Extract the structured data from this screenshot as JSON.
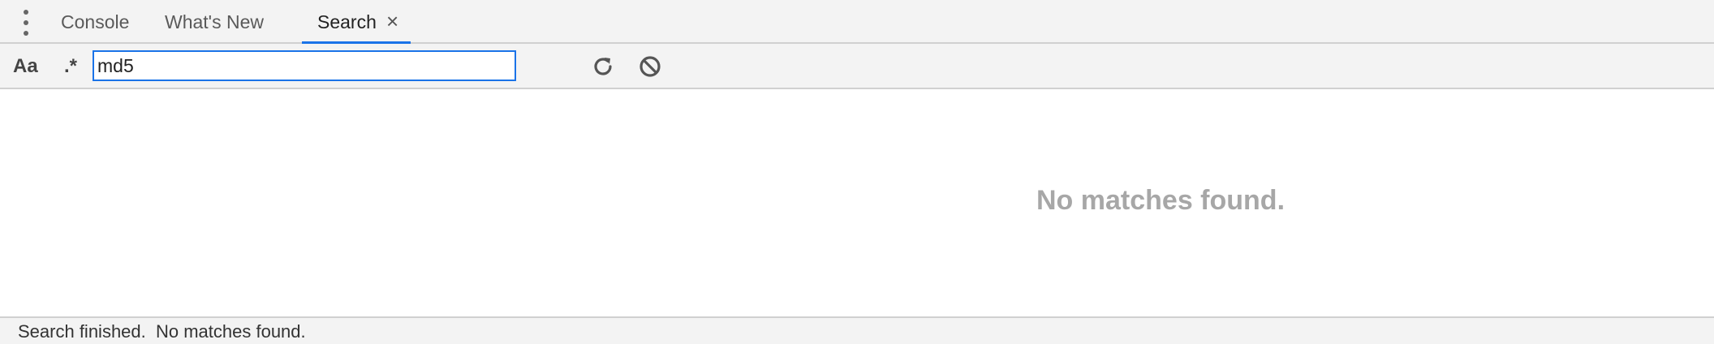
{
  "tabs": [
    {
      "label": "Console",
      "active": false
    },
    {
      "label": "What's New",
      "active": false
    },
    {
      "label": "Search",
      "active": true,
      "closable": true
    }
  ],
  "tab_close_glyph": "×",
  "toolbar": {
    "match_case_label": "Aa",
    "regex_label": ".*",
    "search_value": "md5",
    "refresh_icon": "refresh-icon",
    "clear_icon": "clear-icon"
  },
  "content": {
    "empty_message": "No matches found."
  },
  "status": {
    "text": "Search finished.  No matches found."
  },
  "colors": {
    "accent": "#1a73e8",
    "empty_text": "#a7a7a7"
  }
}
